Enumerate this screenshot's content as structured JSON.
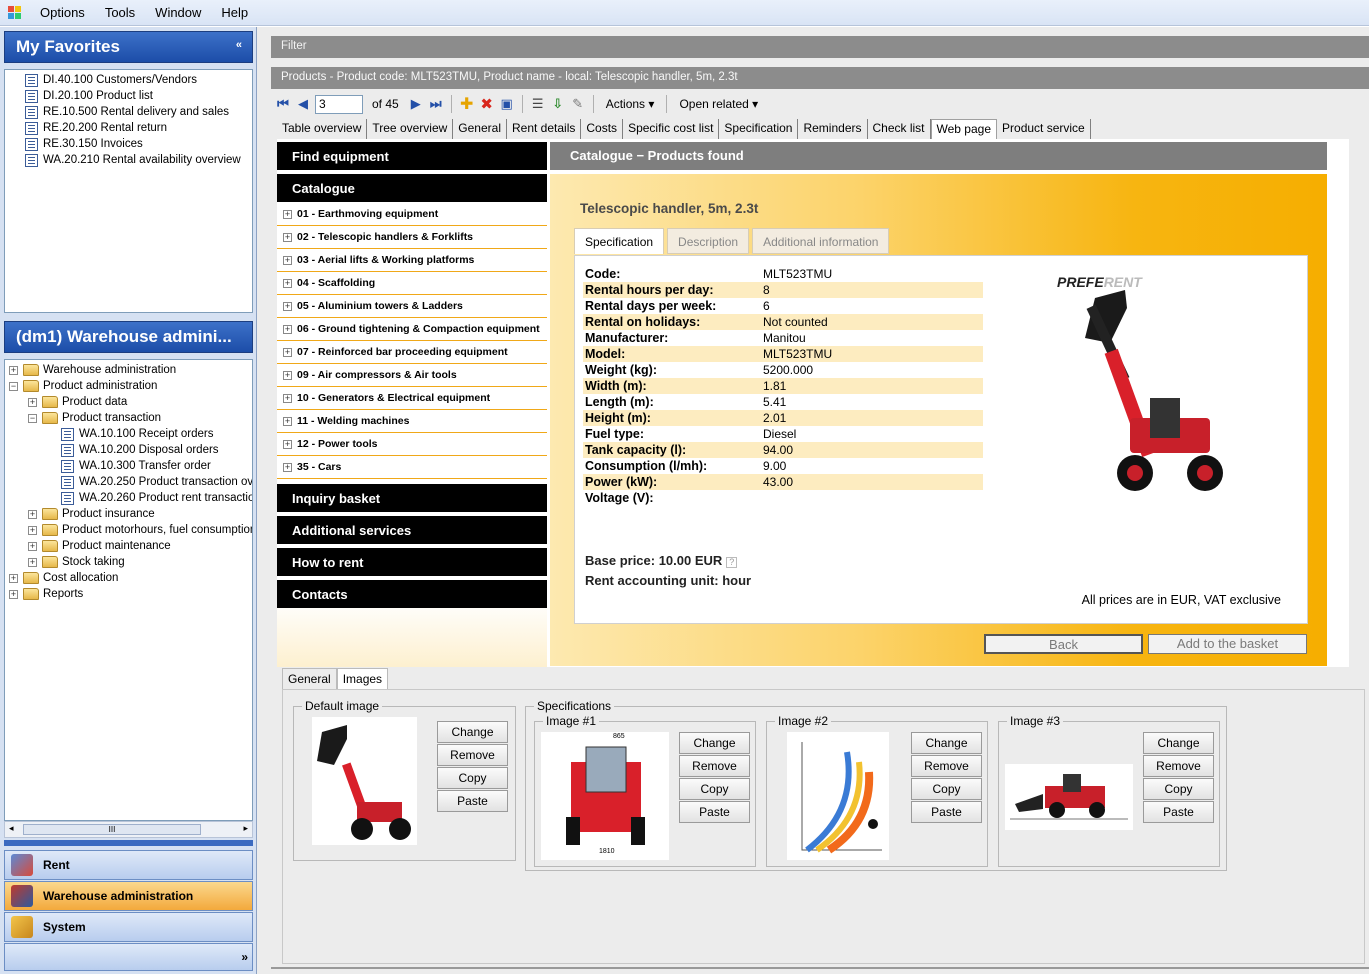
{
  "menubar": {
    "items": [
      "Options",
      "Tools",
      "Window",
      "Help"
    ]
  },
  "favorites": {
    "title": "My Favorites",
    "items": [
      "DI.40.100 Customers/Vendors",
      "DI.20.100 Product list",
      "RE.10.500 Rental delivery and sales",
      "RE.20.200 Rental return",
      "RE.30.150 Invoices",
      "WA.20.210 Rental availability overview"
    ]
  },
  "module": {
    "title": "(dm1) Warehouse admini...",
    "tree": [
      {
        "label": "Warehouse administration",
        "level": 0,
        "type": "folder",
        "exp": "+"
      },
      {
        "label": "Product administration",
        "level": 0,
        "type": "folder",
        "exp": "−"
      },
      {
        "label": "Product data",
        "level": 1,
        "type": "folder",
        "exp": "+"
      },
      {
        "label": "Product transaction",
        "level": 1,
        "type": "folder",
        "exp": "−"
      },
      {
        "label": "WA.10.100 Receipt orders",
        "level": 2,
        "type": "doc"
      },
      {
        "label": "WA.10.200 Disposal orders",
        "level": 2,
        "type": "doc"
      },
      {
        "label": "WA.10.300 Transfer order",
        "level": 2,
        "type": "doc"
      },
      {
        "label": "WA.20.250 Product transaction ove",
        "level": 2,
        "type": "doc"
      },
      {
        "label": "WA.20.260 Product rent transaction",
        "level": 2,
        "type": "doc"
      },
      {
        "label": "Product insurance",
        "level": 1,
        "type": "folder",
        "exp": "+"
      },
      {
        "label": "Product motorhours, fuel consumption",
        "level": 1,
        "type": "folder",
        "exp": "+"
      },
      {
        "label": "Product maintenance",
        "level": 1,
        "type": "folder",
        "exp": "+"
      },
      {
        "label": "Stock taking",
        "level": 1,
        "type": "folder",
        "exp": "+"
      },
      {
        "label": "Cost allocation",
        "level": 0,
        "type": "folder",
        "exp": "+"
      },
      {
        "label": "Reports",
        "level": 0,
        "type": "folder",
        "exp": "+"
      }
    ],
    "scroll_thumb": "III"
  },
  "nav": {
    "rent": "Rent",
    "warehouse": "Warehouse administration",
    "system": "System",
    "more": "»"
  },
  "filter": {
    "label": "Filter"
  },
  "record": {
    "title": "Products - Product code: MLT523TMU, Product name - local: Telescopic handler, 5m, 2.3t"
  },
  "toolbar": {
    "record_no": "3",
    "of_total": "of 45",
    "actions": "Actions",
    "open_related": "Open related"
  },
  "tabs": [
    "Table overview",
    "Tree overview",
    "General",
    "Rent details",
    "Costs",
    "Specific cost list",
    "Specification",
    "Reminders",
    "Check list",
    "Web page",
    "Product service"
  ],
  "active_tab": "Web page",
  "web": {
    "find_equipment": "Find equipment",
    "catalogue": "Catalogue",
    "categories": [
      "01 - Earthmoving equipment",
      "02 - Telescopic handlers & Forklifts",
      "03 - Aerial lifts & Working platforms",
      "04 - Scaffolding",
      "05 - Aluminium towers & Ladders",
      "06 - Ground tightening & Compaction equipment",
      "07 - Reinforced bar proceeding equipment",
      "09 - Air compressors & Air tools",
      "10 - Generators & Electrical equipment",
      "11 - Welding machines",
      "12 - Power tools",
      "35 - Cars"
    ],
    "inquiry": "Inquiry basket",
    "additional": "Additional services",
    "how_to_rent": "How to rent",
    "contacts": "Contacts",
    "content_title": "Catalogue − Products found",
    "product_title": "Telescopic handler, 5m, 2.3t",
    "inner_tabs": [
      "Specification",
      "Description",
      "Additional information"
    ],
    "specs": [
      {
        "k": "Code:",
        "v": "MLT523TMU"
      },
      {
        "k": "Rental hours per day:",
        "v": "8"
      },
      {
        "k": "Rental days per week:",
        "v": "6"
      },
      {
        "k": "Rental on holidays:",
        "v": "Not counted"
      },
      {
        "k": "Manufacturer:",
        "v": "Manitou"
      },
      {
        "k": "Model:",
        "v": "MLT523TMU"
      },
      {
        "k": "Weight (kg):",
        "v": "5200.000"
      },
      {
        "k": "Width (m):",
        "v": "1.81"
      },
      {
        "k": "Length (m):",
        "v": "5.41"
      },
      {
        "k": "Height (m):",
        "v": "2.01"
      },
      {
        "k": "Fuel type:",
        "v": "Diesel"
      },
      {
        "k": "Tank capacity (l):",
        "v": "94.00"
      },
      {
        "k": "Consumption (l/mh):",
        "v": "9.00"
      },
      {
        "k": "Power (kW):",
        "v": "43.00"
      },
      {
        "k": "Voltage (V):",
        "v": ""
      }
    ],
    "brand_a": "PREFE",
    "brand_b": "RENT",
    "base_price": "Base price: 10.00 EUR",
    "qmark": "?",
    "unit": "Rent accounting unit: hour",
    "vat_note": "All prices are in EUR, VAT exclusive",
    "back": "Back",
    "add_basket": "Add to the basket"
  },
  "images": {
    "tabs": [
      "General",
      "Images"
    ],
    "default_label": "Default image",
    "specs_label": "Specifications",
    "img1": "Image #1",
    "img2": "Image #2",
    "img3": "Image #3",
    "change": "Change",
    "remove": "Remove",
    "copy": "Copy",
    "paste": "Paste",
    "dim_top": "865",
    "dim_bottom": "1810"
  },
  "colors": {
    "accent": "#f7b511",
    "nav_active": "#f3a93c",
    "panel_head": "#2a5bb8"
  }
}
